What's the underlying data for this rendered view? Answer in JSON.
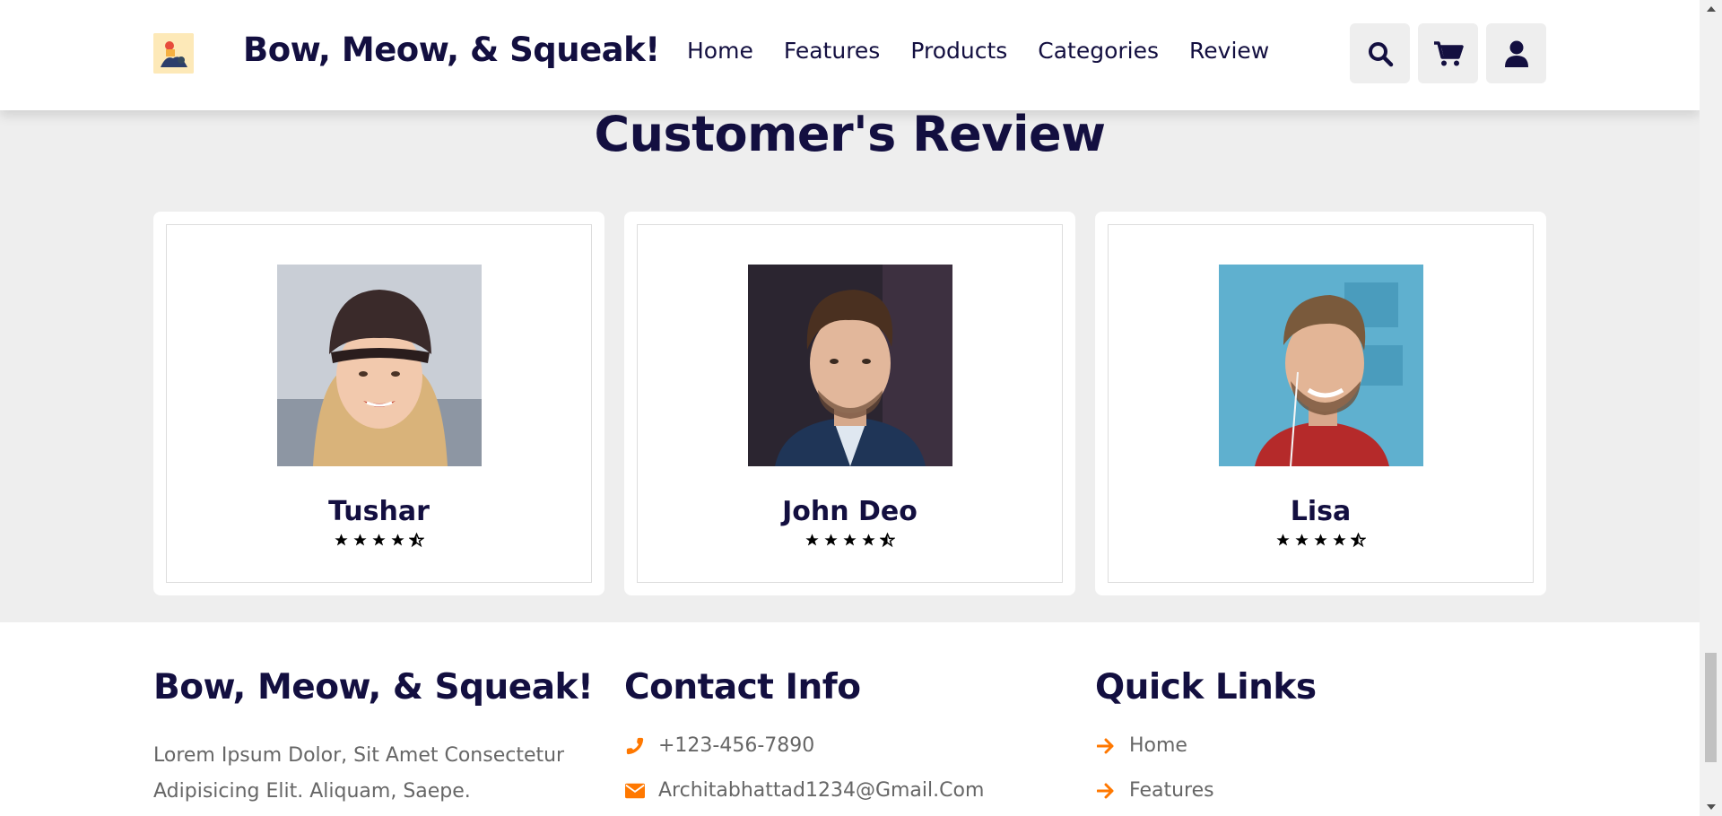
{
  "header": {
    "brand": "Bow, Meow, & Squeak!",
    "nav": [
      "Home",
      "Features",
      "Products",
      "Categories",
      "Review"
    ],
    "icons": [
      "search-icon",
      "cart-icon",
      "user-icon"
    ]
  },
  "review": {
    "title": "Customer's Review",
    "cards": [
      {
        "name": "Tushar",
        "rating": 4.5
      },
      {
        "name": "John Deo",
        "rating": 4.5
      },
      {
        "name": "Lisa",
        "rating": 4.5
      }
    ]
  },
  "footer": {
    "about": {
      "title": "Bow, Meow, & Squeak!",
      "text": "Lorem Ipsum Dolor, Sit Amet Consectetur Adipisicing Elit. Aliquam, Saepe."
    },
    "contact": {
      "title": "Contact Info",
      "phone": "+123-456-7890",
      "email": "Architabhattad1234@Gmail.Com"
    },
    "links": {
      "title": "Quick Links",
      "items": [
        "Home",
        "Features"
      ]
    }
  },
  "colors": {
    "primary_text": "#130f40",
    "accent": "#ff7800",
    "section_bg": "#eeeeee"
  }
}
